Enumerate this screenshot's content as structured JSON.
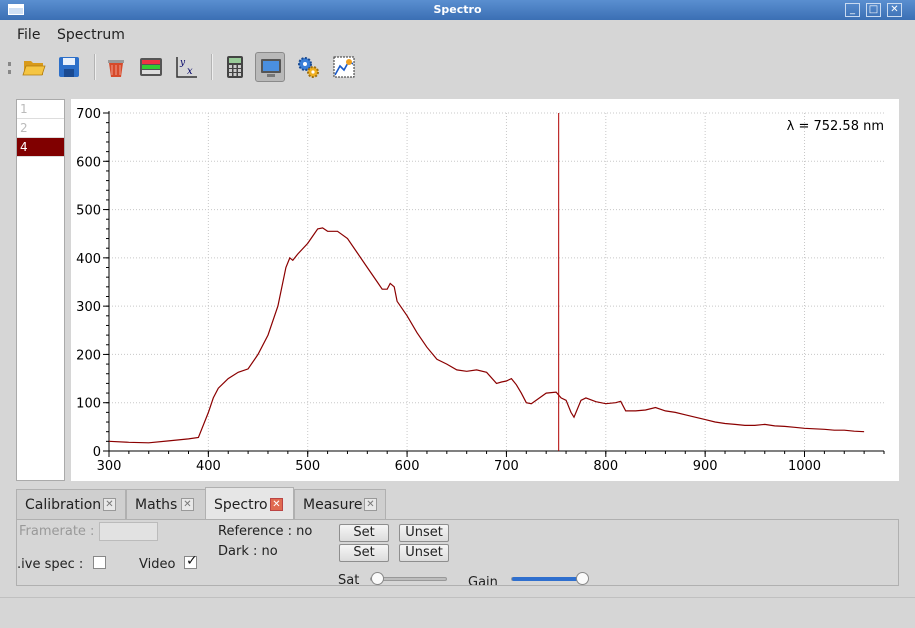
{
  "window": {
    "title": "Spectro"
  },
  "menu": [
    "File",
    "Spectrum"
  ],
  "toolbar": [
    "open-folder-icon",
    "save-icon",
    "trash-icon",
    "spectra-icon",
    "axis-icon",
    "calculator-icon",
    "monitor-icon",
    "settings-icon",
    "plot-options-icon"
  ],
  "spectrum_list": [
    {
      "label": "1",
      "selected": false
    },
    {
      "label": "2",
      "selected": false
    },
    {
      "label": "4",
      "selected": true
    }
  ],
  "cursor_readout": "λ = 752.58 nm",
  "tabs": [
    {
      "label": "Calibration",
      "active": false
    },
    {
      "label": "Maths",
      "active": false
    },
    {
      "label": "Spectro",
      "active": true
    },
    {
      "label": "Measure",
      "active": false
    }
  ],
  "spectro_panel": {
    "framerate_label": "Framerate :",
    "framerate_value": "",
    "live_spec_label": ".ive spec :",
    "live_spec_checked": false,
    "video_label": "Video",
    "video_checked": true,
    "reference_label": "Reference : no",
    "dark_label": "Dark : no",
    "set_label": "Set",
    "unset_label": "Unset",
    "sat_label": "Sat",
    "sat_value": 0,
    "gain_label": "Gain",
    "gain_value": 1
  },
  "colors": {
    "trace": "#8b0000",
    "cursor": "#b00000",
    "selection": "#800000",
    "titlebar": "#4a7fc4"
  },
  "chart_data": {
    "type": "line",
    "title": "",
    "xlabel": "",
    "ylabel": "",
    "xlim": [
      300,
      1080
    ],
    "ylim": [
      0,
      700
    ],
    "grid": true,
    "xticks": [
      300,
      400,
      500,
      600,
      700,
      800,
      900,
      1000
    ],
    "yticks": [
      0,
      100,
      200,
      300,
      400,
      500,
      600,
      700
    ],
    "cursor_x": 752.58,
    "series": [
      {
        "x": [
          300,
          320,
          340,
          360,
          380,
          390,
          400,
          405,
          410,
          420,
          430,
          440,
          450,
          460,
          470,
          478,
          482,
          485,
          490,
          500,
          505,
          510,
          515,
          520,
          530,
          540,
          550,
          560,
          570,
          575,
          580,
          583,
          587,
          590,
          600,
          610,
          620,
          630,
          640,
          650,
          660,
          670,
          680,
          690,
          695,
          700,
          705,
          710,
          715,
          720,
          725,
          730,
          740,
          750,
          755,
          760,
          765,
          768,
          770,
          775,
          780,
          790,
          800,
          810,
          815,
          820,
          830,
          840,
          850,
          860,
          870,
          880,
          890,
          900,
          910,
          920,
          930,
          940,
          950,
          960,
          970,
          980,
          990,
          1000,
          1010,
          1020,
          1030,
          1040,
          1050,
          1060
        ],
        "y": [
          20,
          18,
          17,
          21,
          25,
          28,
          80,
          110,
          130,
          150,
          163,
          170,
          200,
          240,
          300,
          380,
          400,
          395,
          408,
          430,
          445,
          460,
          462,
          455,
          455,
          440,
          410,
          380,
          350,
          335,
          335,
          347,
          340,
          310,
          280,
          245,
          215,
          190,
          180,
          168,
          165,
          168,
          163,
          140,
          143,
          145,
          150,
          137,
          120,
          100,
          98,
          105,
          120,
          122,
          110,
          105,
          80,
          70,
          80,
          105,
          110,
          102,
          98,
          100,
          103,
          83,
          83,
          85,
          90,
          83,
          80,
          75,
          70,
          65,
          60,
          57,
          55,
          53,
          53,
          55,
          52,
          51,
          49,
          47,
          46,
          45,
          43,
          43,
          41,
          40
        ]
      }
    ]
  }
}
